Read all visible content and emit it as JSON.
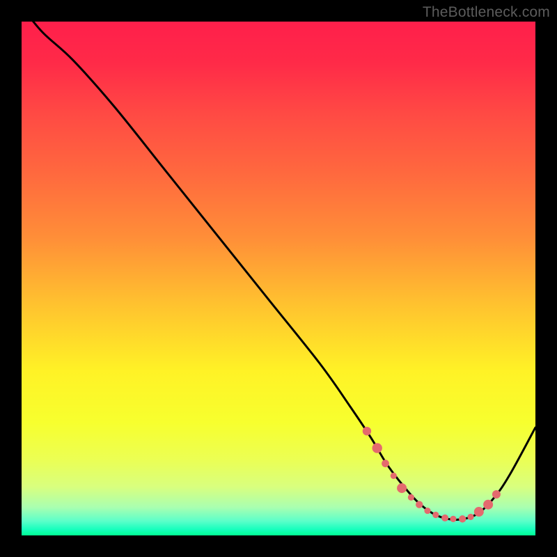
{
  "attribution": "TheBottleneck.com",
  "colors": {
    "frame": "#000000",
    "curve": "#000000",
    "marker_fill": "#e46a6e",
    "marker_stroke": "#b8494d",
    "gradient_stops": [
      {
        "offset": 0.0,
        "color": "#ff1f4b"
      },
      {
        "offset": 0.08,
        "color": "#ff2a48"
      },
      {
        "offset": 0.18,
        "color": "#ff4a44"
      },
      {
        "offset": 0.3,
        "color": "#ff6a3e"
      },
      {
        "offset": 0.42,
        "color": "#ff8e38"
      },
      {
        "offset": 0.55,
        "color": "#ffc22f"
      },
      {
        "offset": 0.68,
        "color": "#fff226"
      },
      {
        "offset": 0.78,
        "color": "#f7ff2e"
      },
      {
        "offset": 0.85,
        "color": "#ecff52"
      },
      {
        "offset": 0.905,
        "color": "#d9ff7e"
      },
      {
        "offset": 0.945,
        "color": "#aaffb0"
      },
      {
        "offset": 0.972,
        "color": "#5cffc9"
      },
      {
        "offset": 0.988,
        "color": "#18ffbe"
      },
      {
        "offset": 1.0,
        "color": "#00ff94"
      }
    ]
  },
  "chart_data": {
    "type": "line",
    "title": "",
    "xlabel": "",
    "ylabel": "",
    "xlim": [
      0,
      100
    ],
    "ylim": [
      0,
      100
    ],
    "grid": false,
    "legend": false,
    "series": [
      {
        "name": "curve",
        "x": [
          0,
          4,
          10,
          18,
          28,
          38,
          48,
          58,
          64,
          68,
          71,
          74,
          77,
          80,
          83,
          86,
          89,
          92,
          95,
          100
        ],
        "y": [
          103,
          98,
          92.5,
          83.5,
          71,
          58.5,
          46,
          33.5,
          25,
          19,
          14,
          10,
          6.6,
          4.3,
          3.2,
          3.2,
          4.4,
          7.4,
          11.8,
          21
        ]
      }
    ],
    "markers": {
      "name": "highlight-points",
      "x": [
        67.2,
        69.2,
        70.8,
        72.4,
        74.0,
        75.8,
        77.4,
        79.0,
        80.6,
        82.4,
        84.0,
        85.8,
        87.4,
        89.0,
        90.8,
        92.4
      ],
      "y": [
        20.3,
        17.0,
        14.0,
        11.6,
        9.2,
        7.4,
        6.0,
        4.8,
        4.0,
        3.4,
        3.2,
        3.2,
        3.6,
        4.6,
        6.0,
        8.0
      ],
      "r": [
        6.2,
        7.2,
        5.4,
        4.6,
        7.0,
        4.6,
        5.2,
        4.6,
        4.6,
        5.0,
        4.6,
        5.2,
        4.6,
        7.0,
        7.0,
        6.0
      ]
    }
  }
}
